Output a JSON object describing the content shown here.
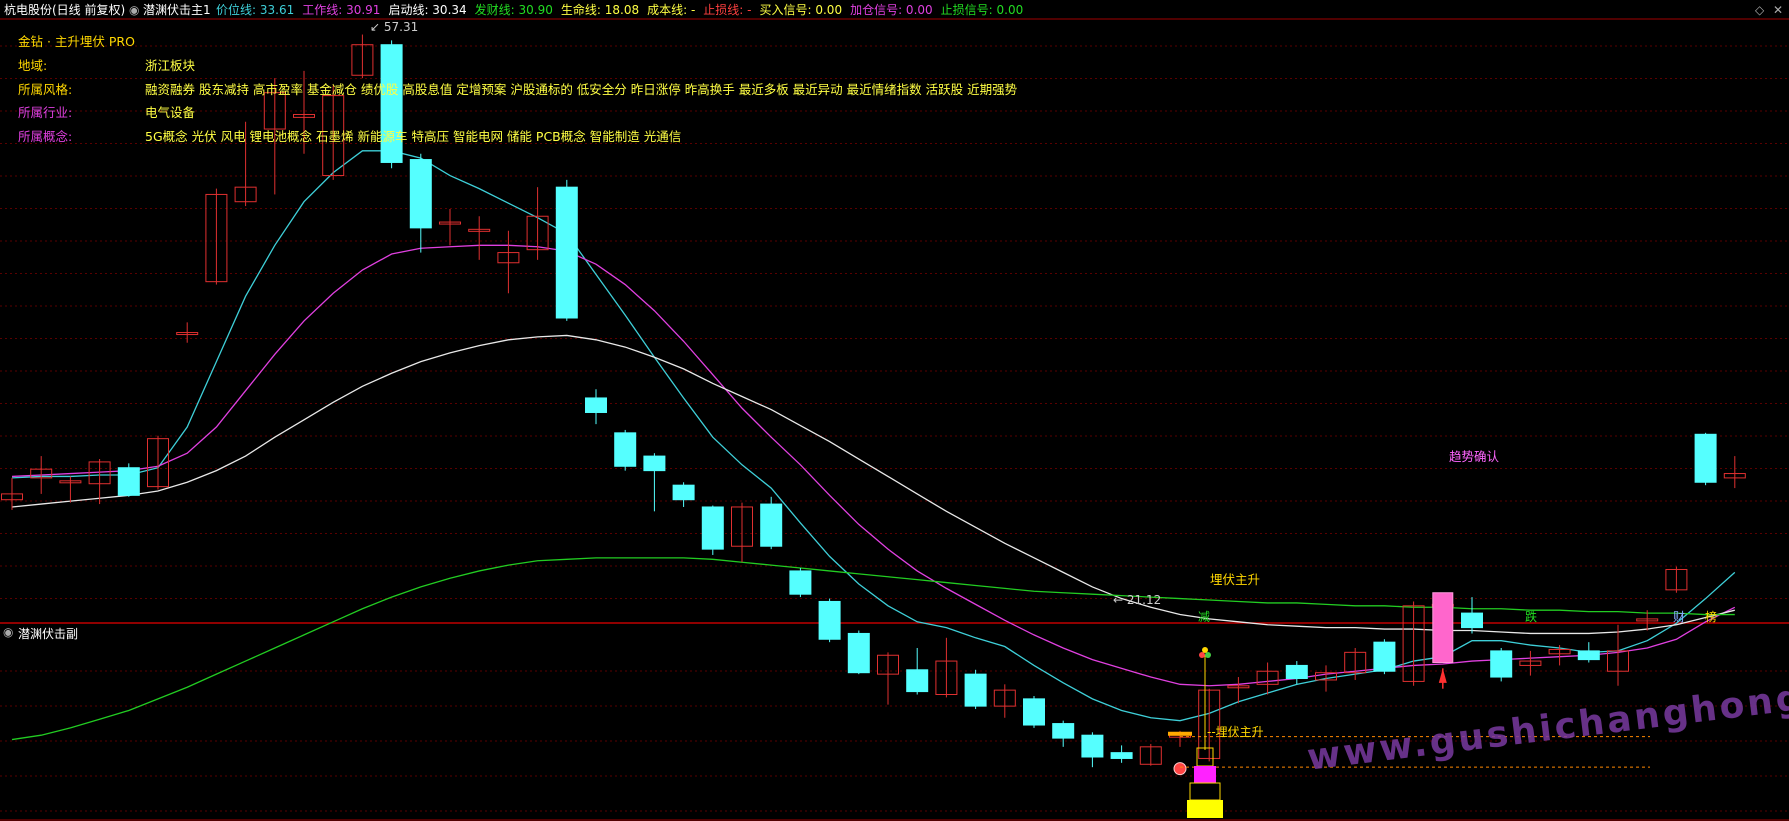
{
  "header": {
    "stock_title": "杭电股份(日线 前复权)",
    "indicator_name": "潜渊伏击主1",
    "fields": [
      {
        "label": "价位线: ",
        "value": "33.61",
        "color": "#3ecfd8"
      },
      {
        "label": "工作线: ",
        "value": "30.91",
        "color": "#e040e0"
      },
      {
        "label": "启动线: ",
        "value": "30.34",
        "color": "#ffffff"
      },
      {
        "label": "发财线: ",
        "value": "30.90",
        "color": "#22dd22"
      },
      {
        "label": "生命线: ",
        "value": "18.08",
        "color": "#ffff44"
      },
      {
        "label": "成本线: ",
        "value": "-",
        "color": "#ffff44"
      },
      {
        "label": "止损线: ",
        "value": "-",
        "color": "#ff4040"
      },
      {
        "label": "买入信号: ",
        "value": "0.00",
        "color": "#ffff44"
      },
      {
        "label": "加仓信号: ",
        "value": "0.00",
        "color": "#e040e0"
      },
      {
        "label": "止损信号: ",
        "value": "0.00",
        "color": "#22dd22"
      }
    ]
  },
  "info_panel": [
    {
      "label": "金钻 · 主升埋伏 PRO",
      "value": "",
      "label_color": "#ffd700"
    },
    {
      "label": "地域:",
      "value": "浙江板块",
      "label_color": "#ffd700"
    },
    {
      "label": "所属风格:",
      "value": "融资融券 股东减持 高市盈率 基金减仓 绩优股 高股息值 定增预案 沪股通标的 低安全分 昨日涨停 昨高换手 最近多板 最近异动 最近情绪指数 活跃股 近期强势",
      "label_color": "#ffd700"
    },
    {
      "label": "所属行业:",
      "value": "电气设备",
      "label_color": "#e040e0"
    },
    {
      "label": "所属概念:",
      "value": "5G概念 光伏 风电 锂电池概念 石墨烯 新能源车 特高压 智能电网 储能 PCB概念 智能制造 光通信",
      "label_color": "#e040e0"
    }
  ],
  "annotations": {
    "high_price": "57.31",
    "low_price": "21.12",
    "signal_main": "埋伏主升",
    "signal_confirm": "趋势确认",
    "bottom_tags": [
      "减",
      "跌",
      "财",
      "榜"
    ]
  },
  "sub_panel": {
    "title": "潜渊伏击副",
    "signal_label": "--埋伏主升"
  },
  "watermark": "www.gushichanghong.com",
  "colors": {
    "background": "#000000",
    "grid": "#5a0000",
    "up_candle": "#e03030",
    "down_candle": "#55ffff",
    "ma_short": "#3ecfd8",
    "ma_mid": "#e040e0",
    "ma_long": "#e8e8e8",
    "ma_life": "#22cc22"
  },
  "chart_data": {
    "type": "candlestick",
    "y_range": [
      18,
      59
    ],
    "candles": [
      {
        "o": 26.0,
        "c": 26.4,
        "h": 27.5,
        "l": 25.3
      },
      {
        "o": 27.5,
        "c": 28.1,
        "h": 29.0,
        "l": 26.4
      },
      {
        "o": 27.3,
        "c": 27.3,
        "h": 27.6,
        "l": 25.8
      },
      {
        "o": 27.1,
        "c": 28.6,
        "h": 28.8,
        "l": 25.7
      },
      {
        "o": 28.2,
        "c": 26.3,
        "h": 28.5,
        "l": 26.2
      },
      {
        "o": 26.9,
        "c": 30.2,
        "h": 30.4,
        "l": 26.7
      },
      {
        "o": 37.5,
        "c": 37.5,
        "h": 38.2,
        "l": 36.8
      },
      {
        "o": 41.0,
        "c": 47.0,
        "h": 47.4,
        "l": 40.8
      },
      {
        "o": 46.5,
        "c": 47.5,
        "h": 52.0,
        "l": 46.2
      },
      {
        "o": 51.5,
        "c": 54.0,
        "h": 55.0,
        "l": 47.0
      },
      {
        "o": 52.3,
        "c": 52.5,
        "h": 55.5,
        "l": 49.8
      },
      {
        "o": 48.3,
        "c": 53.8,
        "h": 54.5,
        "l": 48.0
      },
      {
        "o": 55.2,
        "c": 57.3,
        "h": 58.0,
        "l": 55.0
      },
      {
        "o": 57.3,
        "c": 49.2,
        "h": 57.6,
        "l": 48.8
      },
      {
        "o": 49.4,
        "c": 44.7,
        "h": 49.8,
        "l": 43.0
      },
      {
        "o": 45.1,
        "c": 45.1,
        "h": 46.0,
        "l": 43.5
      },
      {
        "o": 44.6,
        "c": 44.6,
        "h": 45.5,
        "l": 42.5
      },
      {
        "o": 42.3,
        "c": 43.0,
        "h": 44.5,
        "l": 40.2
      },
      {
        "o": 43.2,
        "c": 45.5,
        "h": 47.5,
        "l": 42.5
      },
      {
        "o": 47.5,
        "c": 38.5,
        "h": 48.0,
        "l": 38.3
      },
      {
        "o": 33.0,
        "c": 32.0,
        "h": 33.6,
        "l": 31.2
      },
      {
        "o": 30.6,
        "c": 28.3,
        "h": 30.8,
        "l": 28.0
      },
      {
        "o": 29.0,
        "c": 28.0,
        "h": 29.2,
        "l": 25.2
      },
      {
        "o": 27.0,
        "c": 26.0,
        "h": 27.2,
        "l": 25.5
      },
      {
        "o": 25.5,
        "c": 22.6,
        "h": 25.6,
        "l": 22.2
      },
      {
        "o": 22.8,
        "c": 25.5,
        "h": 25.8,
        "l": 21.7
      },
      {
        "o": 25.7,
        "c": 22.8,
        "h": 26.2,
        "l": 22.6
      },
      {
        "o": 21.1,
        "c": 19.5,
        "h": 21.3,
        "l": 19.3
      },
      {
        "o": 19.0,
        "c": 16.4,
        "h": 19.2,
        "l": 16.2
      },
      {
        "o": 16.8,
        "c": 14.1,
        "h": 17.0,
        "l": 14.0
      },
      {
        "o": 14.0,
        "c": 15.3,
        "h": 15.5,
        "l": 11.9
      },
      {
        "o": 14.3,
        "c": 12.8,
        "h": 15.8,
        "l": 12.6
      },
      {
        "o": 12.6,
        "c": 14.9,
        "h": 16.5,
        "l": 12.4
      },
      {
        "o": 14.0,
        "c": 11.8,
        "h": 14.3,
        "l": 11.6
      },
      {
        "o": 11.8,
        "c": 12.9,
        "h": 13.3,
        "l": 11.0
      },
      {
        "o": 12.3,
        "c": 10.5,
        "h": 12.5,
        "l": 10.3
      },
      {
        "o": 10.6,
        "c": 9.6,
        "h": 10.8,
        "l": 9.0
      },
      {
        "o": 9.8,
        "c": 8.3,
        "h": 10.0,
        "l": 7.6
      },
      {
        "o": 8.6,
        "c": 8.2,
        "h": 9.1,
        "l": 7.9
      },
      {
        "o": 7.8,
        "c": 9.0,
        "h": 9.2,
        "l": 7.7
      },
      {
        "o": 9.8,
        "c": 9.8,
        "h": 10.1,
        "l": 9.0
      },
      {
        "o": 8.2,
        "c": 12.9,
        "h": 13.0,
        "l": 8.0
      },
      {
        "o": 13.2,
        "c": 13.2,
        "h": 13.8,
        "l": 12.0
      },
      {
        "o": 13.3,
        "c": 14.2,
        "h": 14.8,
        "l": 12.6
      },
      {
        "o": 14.6,
        "c": 13.7,
        "h": 14.9,
        "l": 13.3
      },
      {
        "o": 13.6,
        "c": 14.1,
        "h": 14.6,
        "l": 12.8
      },
      {
        "o": 14.1,
        "c": 15.5,
        "h": 15.8,
        "l": 13.6
      },
      {
        "o": 16.2,
        "c": 14.2,
        "h": 16.4,
        "l": 14.0
      },
      {
        "o": 13.5,
        "c": 18.7,
        "h": 19.0,
        "l": 13.2
      },
      {
        "o": 18.8,
        "c": 18.8,
        "h": 19.2,
        "l": 18.0
      },
      {
        "o": 18.2,
        "c": 17.2,
        "h": 19.3,
        "l": 16.8
      },
      {
        "o": 15.6,
        "c": 13.8,
        "h": 15.8,
        "l": 13.5
      },
      {
        "o": 14.6,
        "c": 14.9,
        "h": 15.6,
        "l": 13.9
      },
      {
        "o": 15.4,
        "c": 15.7,
        "h": 16.0,
        "l": 14.6
      },
      {
        "o": 15.6,
        "c": 15.0,
        "h": 16.2,
        "l": 14.8
      },
      {
        "o": 14.2,
        "c": 15.6,
        "h": 17.4,
        "l": 13.2
      },
      {
        "o": 17.8,
        "c": 17.8,
        "h": 18.4,
        "l": 17.0
      },
      {
        "o": 19.8,
        "c": 21.2,
        "h": 21.4,
        "l": 19.6
      },
      {
        "o": 30.5,
        "c": 27.2,
        "h": 30.6,
        "l": 27.0
      },
      {
        "o": 27.5,
        "c": 27.8,
        "h": 29.0,
        "l": 26.8
      }
    ],
    "series": [
      {
        "name": "价位线",
        "color": "#3ecfd8",
        "values": [
          27.5,
          27.6,
          27.6,
          27.7,
          27.7,
          28.2,
          31.0,
          35.5,
          40.0,
          43.5,
          46.5,
          48.5,
          50.0,
          50.0,
          49.5,
          48.3,
          47.4,
          46.4,
          45.4,
          44.3,
          41.5,
          38.7,
          35.8,
          33.0,
          30.3,
          28.4,
          26.8,
          24.4,
          22.1,
          20.2,
          18.7,
          17.6,
          17.2,
          16.5,
          15.9,
          14.6,
          13.4,
          12.3,
          11.5,
          11.0,
          10.8,
          11.3,
          12.1,
          12.7,
          13.3,
          13.7,
          14.0,
          14.3,
          14.9,
          15.2,
          16.3,
          16.3,
          16.0,
          15.8,
          15.5,
          15.6,
          16.3,
          17.5,
          19.2,
          21.0
        ]
      },
      {
        "name": "工作线",
        "color": "#e040e0",
        "values": [
          27.6,
          27.7,
          27.8,
          27.9,
          28.0,
          28.3,
          29.2,
          31.0,
          33.5,
          36.0,
          38.3,
          40.2,
          41.8,
          42.9,
          43.3,
          43.4,
          43.5,
          43.5,
          43.4,
          43.1,
          42.2,
          40.8,
          39.0,
          36.9,
          34.6,
          32.3,
          30.3,
          28.4,
          26.3,
          24.3,
          22.6,
          21.1,
          19.9,
          18.8,
          17.7,
          16.7,
          15.8,
          15.0,
          14.4,
          13.8,
          13.3,
          13.2,
          13.3,
          13.5,
          13.7,
          14.0,
          14.2,
          14.4,
          14.6,
          14.7,
          14.9,
          15.0,
          15.1,
          15.2,
          15.3,
          15.5,
          15.8,
          16.4,
          17.6,
          18.6
        ]
      },
      {
        "name": "启动线",
        "color": "#e8e8e8",
        "values": [
          25.5,
          25.7,
          25.9,
          26.1,
          26.3,
          26.6,
          27.2,
          28.0,
          29.0,
          30.3,
          31.5,
          32.7,
          33.8,
          34.7,
          35.5,
          36.1,
          36.6,
          37.0,
          37.2,
          37.3,
          37.0,
          36.5,
          35.8,
          35.0,
          34.0,
          33.1,
          32.2,
          31.1,
          30.0,
          28.8,
          27.6,
          26.4,
          25.2,
          24.1,
          23.0,
          22.0,
          21.0,
          20.0,
          19.2,
          18.6,
          18.1,
          17.8,
          17.6,
          17.4,
          17.3,
          17.2,
          17.2,
          17.1,
          17.1,
          17.0,
          17.0,
          16.9,
          16.8,
          16.8,
          16.8,
          16.9,
          17.1,
          17.4,
          17.9,
          18.4
        ]
      },
      {
        "name": "生命线",
        "color": "#22cc22",
        "values": [
          9.5,
          9.8,
          10.3,
          10.9,
          11.5,
          12.3,
          13.1,
          14.0,
          14.9,
          15.8,
          16.7,
          17.6,
          18.5,
          19.3,
          20.0,
          20.6,
          21.1,
          21.5,
          21.8,
          21.9,
          22.0,
          22.0,
          22.0,
          22.0,
          21.9,
          21.7,
          21.5,
          21.3,
          21.1,
          20.9,
          20.7,
          20.5,
          20.3,
          20.1,
          19.9,
          19.7,
          19.6,
          19.5,
          19.4,
          19.3,
          19.2,
          19.1,
          19.0,
          18.9,
          18.9,
          18.8,
          18.7,
          18.7,
          18.6,
          18.6,
          18.5,
          18.5,
          18.4,
          18.4,
          18.3,
          18.3,
          18.2,
          18.2,
          18.1,
          18.1
        ]
      }
    ]
  }
}
